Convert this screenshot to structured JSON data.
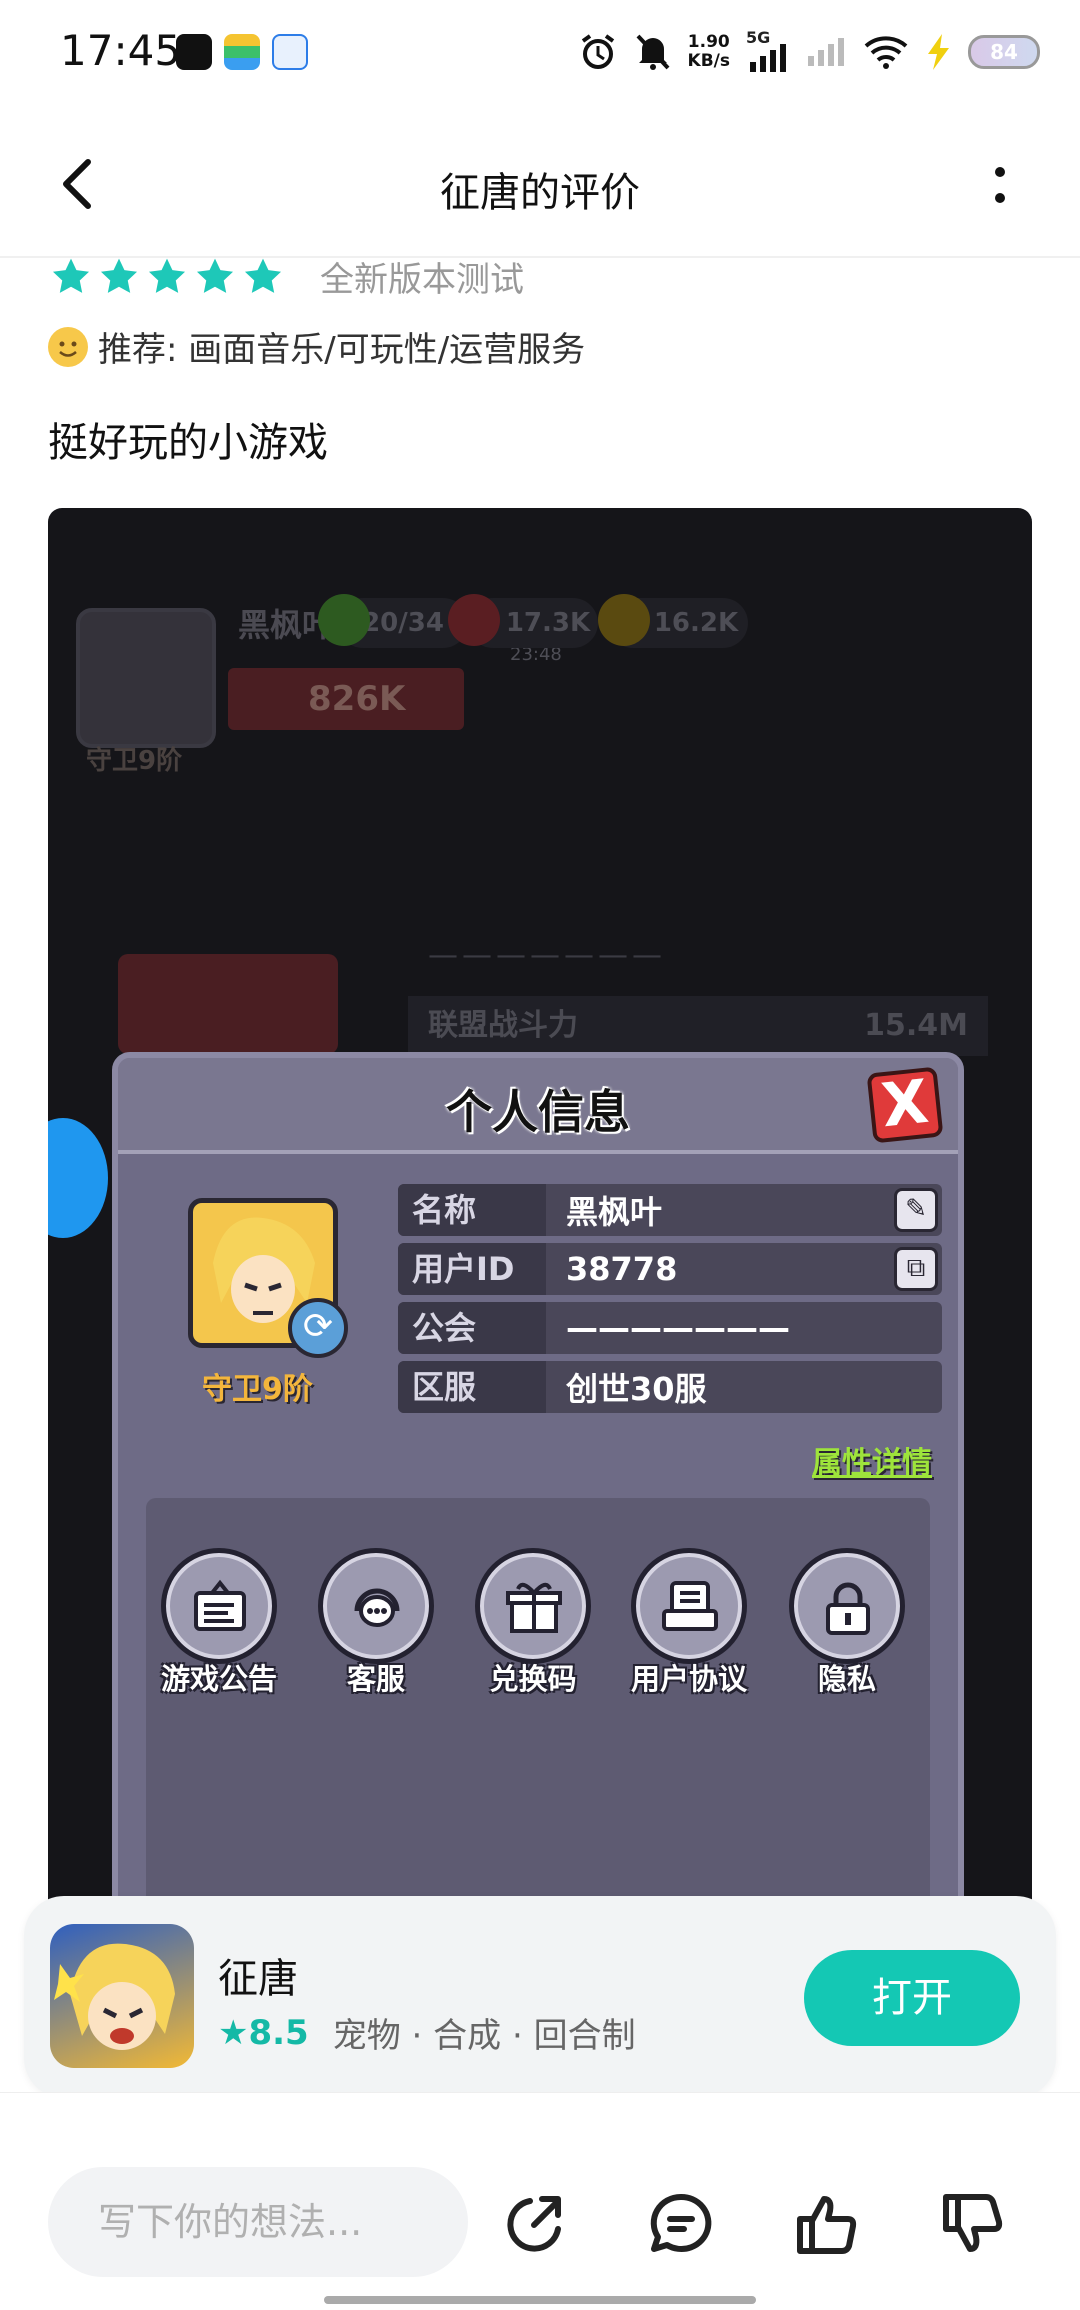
{
  "status_bar": {
    "time": "17:45",
    "net_speed_value": "1.90",
    "net_speed_unit": "KB/s",
    "network_type": "5G",
    "battery": "84"
  },
  "header": {
    "title": "征唐的评价",
    "back_icon": "chevron-left-icon",
    "more_icon": "more-vertical-icon"
  },
  "review": {
    "stars": 5,
    "version_tag": "全新版本测试",
    "recommend": "推荐: 画面音乐/可玩性/运营服务",
    "text": "挺好玩的小游戏"
  },
  "screenshot": {
    "player_name_top": "黑枫叶",
    "avatar_label_top": "守卫9阶",
    "power": "826K",
    "resource_1": "20/34",
    "resource_1_timer": "23:48",
    "resource_2": "17.3K",
    "resource_3": "16.2K",
    "alliance_dashes": "———————",
    "alliance_label": "联盟战斗力",
    "alliance_value": "15.4M",
    "dialog": {
      "title": "个人信息",
      "close_label": "X",
      "avatar_label": "守卫9阶",
      "rows": [
        {
          "key": "名称",
          "value": "黑枫叶"
        },
        {
          "key": "用户ID",
          "value": "38778"
        },
        {
          "key": "公会",
          "value": "———————"
        },
        {
          "key": "区服",
          "value": "创世30服"
        }
      ],
      "attr_link": "属性详情",
      "buttons": [
        {
          "label": "游戏公告",
          "icon": "notice-board-icon"
        },
        {
          "label": "客服",
          "icon": "headset-icon"
        },
        {
          "label": "兑换码",
          "icon": "gift-icon"
        },
        {
          "label": "用户协议",
          "icon": "document-icon"
        },
        {
          "label": "隐私",
          "icon": "lock-icon"
        }
      ]
    }
  },
  "app_card": {
    "name": "征唐",
    "score": "8.5",
    "tags": "宠物 · 合成 · 回合制",
    "open_label": "打开",
    "accent": "#14c8b4"
  },
  "bottom_bar": {
    "input_placeholder": "写下你的想法...",
    "icons": [
      "share-icon",
      "comment-icon",
      "thumbs-up-icon",
      "thumbs-down-icon"
    ]
  }
}
